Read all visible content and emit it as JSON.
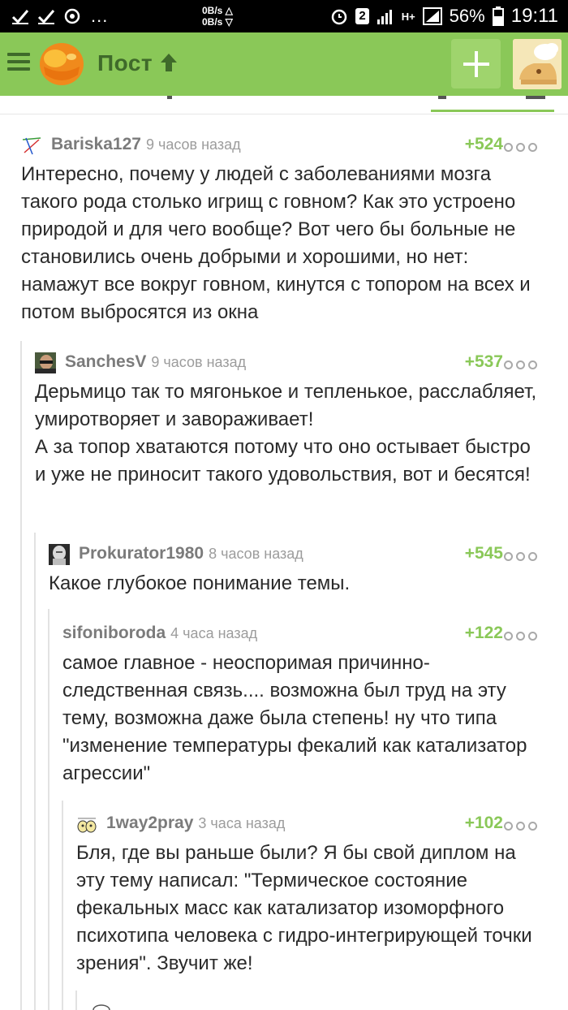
{
  "status_bar": {
    "speed_up": "0B/s △",
    "speed_down": "0B/s ▽",
    "dots": "...",
    "sim_badge": "2",
    "network": "H+",
    "battery": "56%",
    "time": "19:11"
  },
  "toolbar": {
    "title": "Пост",
    "add_label": "+"
  },
  "comments": [
    {
      "author": "Bariska127",
      "time": "9 часов назад",
      "rating": "+524",
      "text": "Интересно, почему у людей с заболеваниями мозга такого рода столько игрищ с говном? Как это устроено природой и для чего вообще? Вот чего бы больные не становились очень добрыми и хорошими, но нет: намажут все вокруг говном, кинутся с топором на всех и потом выбросятся из окна"
    },
    {
      "author": "SanchesV",
      "time": "9 часов назад",
      "rating": "+537",
      "text_lines": [
        "Дерьмицо так то мягонькое и тепленькое, расслабляет, умиротворяет и завораживает!",
        "А за топор хватаются потому что оно остывает быстро и уже не приносит такого удовольствия, вот и бесятся!"
      ]
    },
    {
      "author": "Prokurator1980",
      "time": "8 часов назад",
      "rating": "+545",
      "text": "Какое глубокое понимание темы."
    },
    {
      "author": "sifoniboroda",
      "time": "4 часа назад",
      "rating": "+122",
      "text": "самое главное - неоспоримая причинно-следственная связь.... возможна был труд на эту тему, возможна даже была степень! ну что типа \"изменение температуры фекалий как катализатор агрессии\""
    },
    {
      "author": "1way2pray",
      "time": "3 часа назад",
      "rating": "+102",
      "text": "Бля, где вы раньше были? Я бы свой диплом на эту тему написал: \"Термическое состояние фекальных масс как катализатор изоморфного психотипа человека с гидро-интегрирующей точки зрения\". Звучит же!"
    }
  ]
}
